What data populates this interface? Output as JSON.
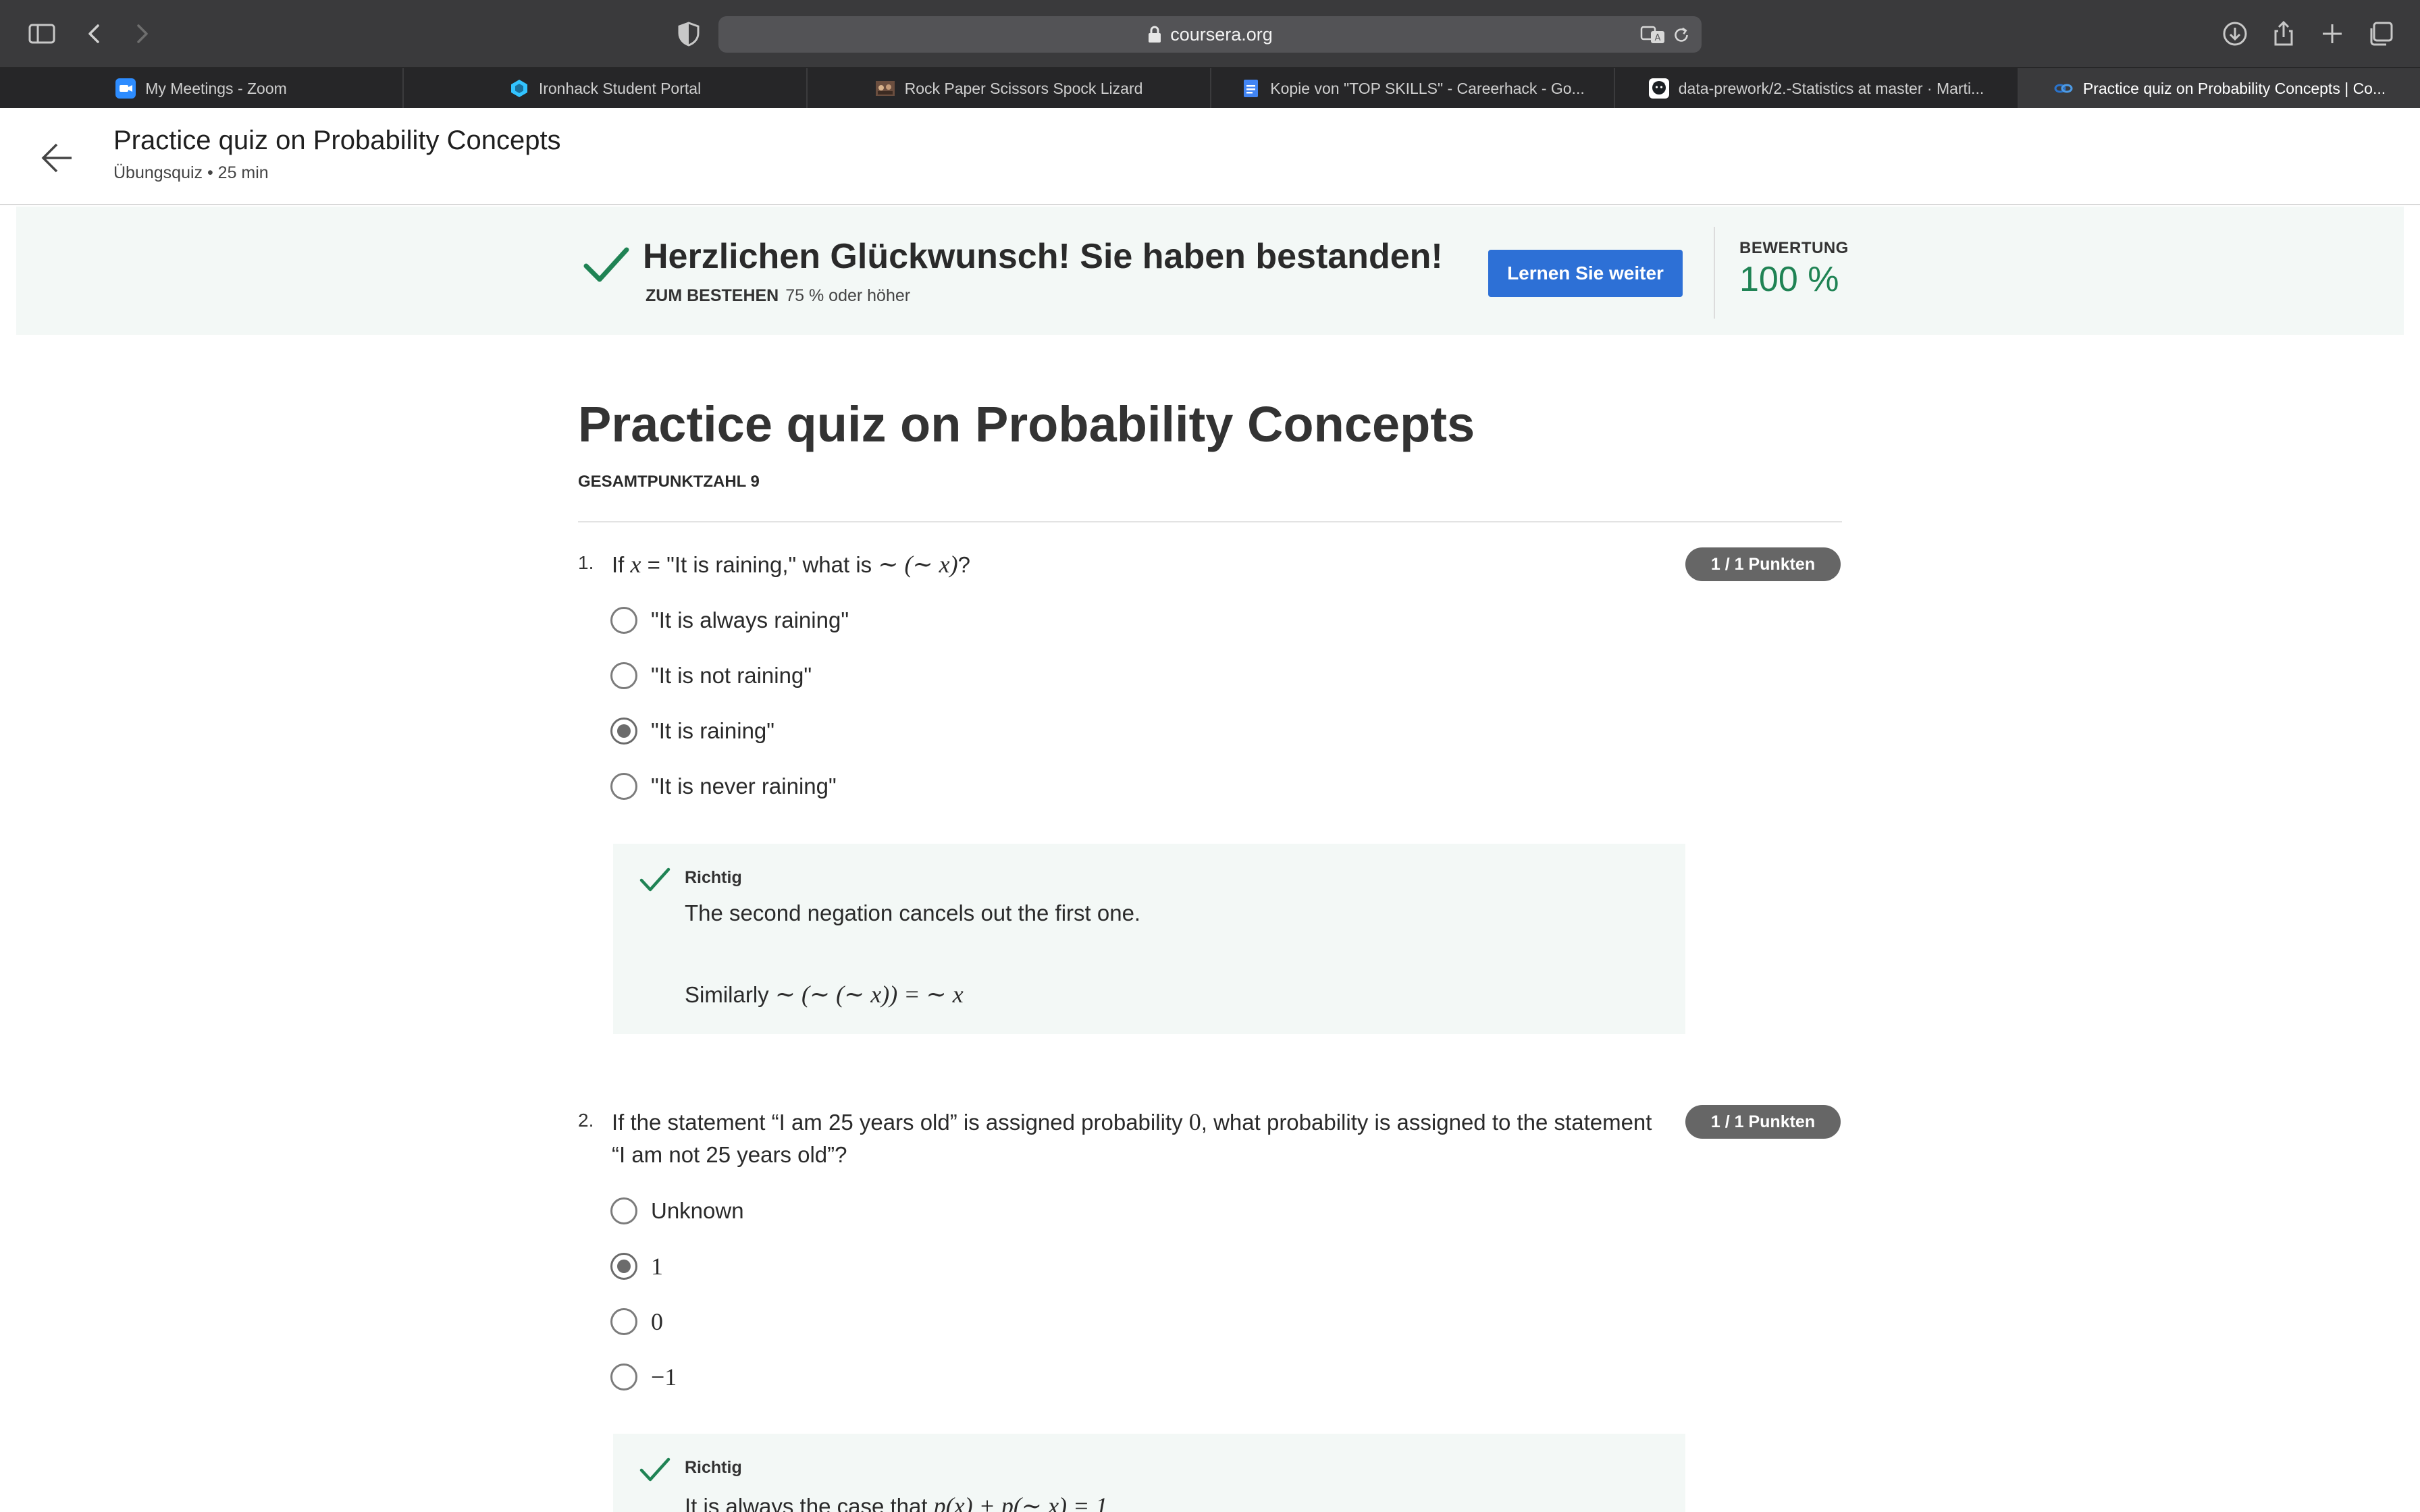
{
  "browser": {
    "url": "coursera.org",
    "tabs": [
      {
        "title": "My Meetings - Zoom",
        "favicon": "zoom-icon",
        "color": "#2d8cff"
      },
      {
        "title": "Ironhack Student Portal",
        "favicon": "ironhack-icon",
        "color": "#32c3ff"
      },
      {
        "title": "Rock Paper Scissors Spock Lizard",
        "favicon": "image-thumbnail-icon",
        "color": "#8a6a5a"
      },
      {
        "title": "Kopie von \"TOP SKILLS\" - Careerhack - Go...",
        "favicon": "google-docs-icon",
        "color": "#4285f4"
      },
      {
        "title": "data-prework/2.-Statistics at master · Marti...",
        "favicon": "github-icon",
        "color": "#ffffff"
      },
      {
        "title": "Practice quiz on Probability Concepts | Co...",
        "favicon": "coursera-icon",
        "color": "#2a73cc"
      }
    ]
  },
  "header": {
    "title": "Practice quiz on Probability Concepts",
    "subtitle": "Übungsquiz • 25 min"
  },
  "banner": {
    "title": "Herzlichen Glückwunsch! Sie haben bestanden!",
    "pass_label": "ZUM BESTEHEN",
    "pass_value": "75 % oder höher",
    "continue_label": "Lernen Sie weiter",
    "grade_label": "BEWERTUNG",
    "grade_value": "100 %"
  },
  "quiz": {
    "title": "Practice quiz on Probability Concepts",
    "total_points": "GESAMTPUNKTZAHL 9",
    "questions": [
      {
        "number": "1.",
        "text_prefix": "If ",
        "text_math1": "x",
        "text_mid": " = \"It is raining,\" what is ",
        "text_math2": "∼ (∼ x)",
        "text_suffix": "?",
        "points": "1 / 1 Punkten",
        "options": [
          "\"It is always raining\"",
          "\"It is not raining\"",
          "\"It is raining\"",
          "\"It is never raining\""
        ],
        "selected_index": 2,
        "feedback_label": "Richtig",
        "feedback_line1": "The second negation cancels out the first one.",
        "feedback_line2_prefix": "Similarly ",
        "feedback_line2_math": "∼ (∼ (∼ x)) = ∼ x"
      },
      {
        "number": "2.",
        "text_line1_prefix": "If the statement “I am 25 years old” is assigned probability ",
        "text_line1_math": "0",
        "text_line1_suffix": ", what probability is assigned to the statement",
        "text_line2": "“I am not 25 years old”?",
        "points": "1 / 1 Punkten",
        "options": [
          "Unknown",
          "1",
          "0",
          "−1"
        ],
        "selected_index": 1,
        "feedback_label": "Richtig",
        "feedback_line1_prefix": "It is always the case that ",
        "feedback_line1_math": "p(x) + p(∼ x) = 1"
      }
    ]
  },
  "colors": {
    "accent": "#2d70d6",
    "success": "#1f8354",
    "banner_bg": "#f3f8f6",
    "badge_bg": "#666666"
  }
}
